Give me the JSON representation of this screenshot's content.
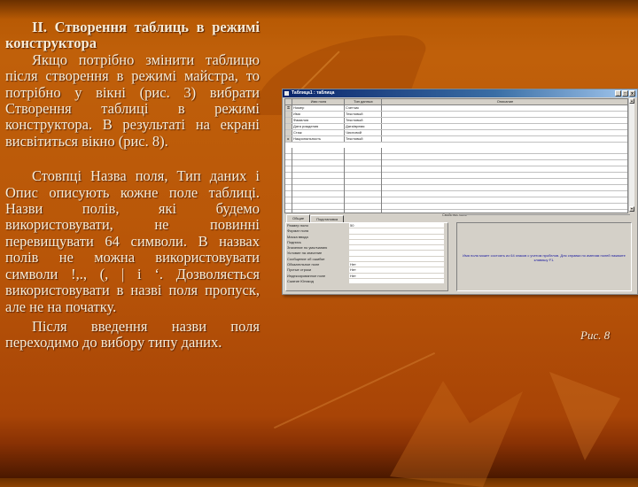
{
  "slide": {
    "heading": "II. Створення таблиць в режимі конструктора",
    "paragraphs": [
      "Якщо потрібно змінити таблицю після створення в режимі майстра, то потрібно у вікні (рис. 3) вибрати Створення таблиці в режимі конструктора. В результаті на екрані висвітиться вікно (рис. 8).",
      "Стовпці Назва поля, Тип даних і Опис описують кожне поле таблиці. Назви полів, які будемо використовувати, не повинні перевищувати 64 символи. В назвах полів не можна використовувати символи !,., (, | і ‘. Дозволяється використовувати в назві поля пропуск, але не на початку.",
      "Після введення назви поля переходимо до вибору типу даних."
    ],
    "figure_caption": "Рис. 8"
  },
  "access_window": {
    "title": "Таблица1 : таблица",
    "window_buttons": [
      "_",
      "□",
      "x"
    ],
    "grid": {
      "headers": [
        "Имя поля",
        "Тип данных",
        "Описание"
      ],
      "rows": [
        {
          "marker": "⚿",
          "field": "Номер",
          "type": "Счетчик",
          "description": ""
        },
        {
          "marker": "",
          "field": "Имя",
          "type": "Текстовый",
          "description": ""
        },
        {
          "marker": "",
          "field": "Фамилия",
          "type": "Текстовый",
          "description": ""
        },
        {
          "marker": "",
          "field": "Дата рождения",
          "type": "Дата/время",
          "description": ""
        },
        {
          "marker": "",
          "field": "Стаж",
          "type": "Числовой",
          "description": ""
        },
        {
          "marker": "▸",
          "field": "Национальность",
          "type": "Текстовый",
          "description": ""
        }
      ]
    },
    "properties_label": "Свойства поля",
    "tabs": [
      "Общие",
      "Подстановка"
    ],
    "properties": [
      {
        "label": "Размер поля",
        "value": "50"
      },
      {
        "label": "Формат поля",
        "value": ""
      },
      {
        "label": "Маска ввода",
        "value": ""
      },
      {
        "label": "Подпись",
        "value": ""
      },
      {
        "label": "Значение по умолчанию",
        "value": ""
      },
      {
        "label": "Условие на значение",
        "value": ""
      },
      {
        "label": "Сообщение об ошибке",
        "value": ""
      },
      {
        "label": "Обязательное поле",
        "value": "Нет"
      },
      {
        "label": "Пустые строки",
        "value": "Нет"
      },
      {
        "label": "Индексированное поле",
        "value": "Нет"
      },
      {
        "label": "Сжатие Юникод",
        "value": ""
      }
    ],
    "hint": "Имя поля может состоять из 64 знаков с учетом пробелов. Для справки по именам полей нажмите клавишу F1."
  }
}
